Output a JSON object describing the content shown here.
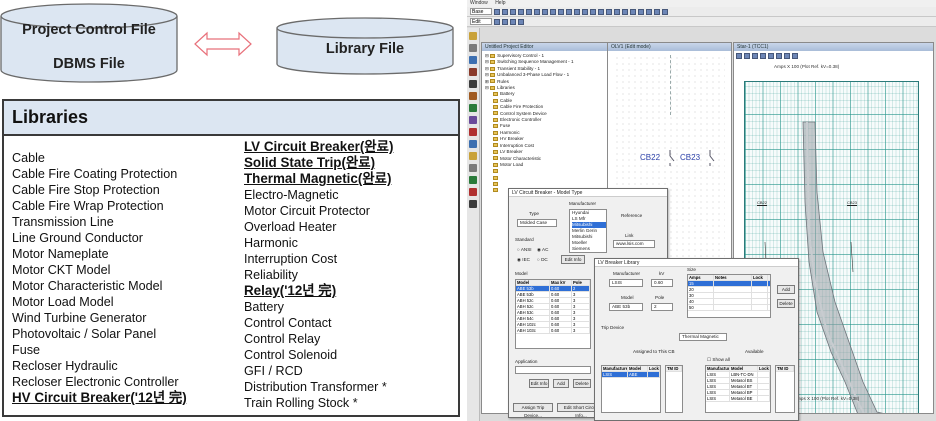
{
  "db": {
    "project_control_file": "Project Control File",
    "dbms_file": "DBMS File",
    "library_file": "Library File"
  },
  "libraries": {
    "title": "Libraries",
    "left_column": [
      "Cable",
      "Cable Fire Coating Protection",
      "Cable Fire Stop Protection",
      "Cable Fire Wrap Protection",
      "Transmission Line",
      "Line Ground Conductor",
      "Motor Nameplate",
      "Motor CKT Model",
      "Motor Characteristic Model",
      "Motor Load Model",
      "Wind Turbine Generator",
      "Photovoltaic / Solar Panel",
      "Fuse",
      "Recloser Hydraulic",
      "Recloser Electronic Controller",
      "HV Circuit Breaker('12년 完)"
    ],
    "right_column": [
      "LV Circuit Breaker(완료)",
      "Solid State Trip(완료)",
      "Thermal Magnetic(완료)",
      "Electro-Magnetic",
      "Motor Circuit Protector",
      "Overload Heater",
      "Harmonic",
      "Interruption Cost",
      "Reliability",
      "Relay('12년 完)",
      "Battery",
      "Control Contact",
      "Control Relay",
      "Control Solenoid",
      "GFI / RCD",
      "Distribution Transformer *",
      "Train Rolling Stock *"
    ]
  },
  "app": {
    "menu": [
      "Window",
      "Help"
    ],
    "toolbar_selects": [
      "Base",
      "Edit"
    ],
    "project_window_title": "Untitled Project Editor",
    "oneline_window_title": "OLV1 (Edit mode)",
    "tcc_window_title": "Star-1 (TCC1)",
    "tcc_header": "Amps X 100 (Plot Ref. kV=0.38)",
    "tcc_footer": "Amps X 100 (Plot Ref. kV=0.38)",
    "tcc_label_cb22": "CB22",
    "tcc_label_cb23": "CB23",
    "tree": [
      "Supervisory Control - 1",
      "Switching Sequence Management - 1",
      "Transient Stability - 1",
      "Unbalanced 3-Phase Load Flow - 1",
      "Rules",
      "Libraries",
      "Battery",
      "Cable",
      "Cable Fire Protection",
      "Control System Device",
      "Electronic Controller",
      "Fuse",
      "Harmonic",
      "HV Breaker",
      "Interruption Cost",
      "LV Breaker",
      "Motor Characteristic",
      "Motor Load"
    ],
    "cb22": "CB22",
    "cb23": "CB23",
    "lv_select": {
      "title": "LV Circuit Breaker - Model Type",
      "manufacturer_label": "Manufacturer",
      "manufacturers": [
        "Hyundai",
        "LS Mfr",
        "Mitsubishi",
        "Merlin Gerin",
        "Mitsubishi",
        "Moeller",
        "Siemens"
      ],
      "type_label": "Type",
      "type_value": "Molded Case",
      "reference_label": "Reference",
      "link_label": "Link",
      "link_value": "www.lsis.com",
      "standard_label": "Standard",
      "std_opts": [
        "ANSI",
        "IEC",
        "AC",
        "DC"
      ],
      "model_label": "Model",
      "model_headers": [
        "Model",
        "Max kV",
        "Pole"
      ],
      "models": [
        [
          "ABE 53b",
          "0.60",
          "2"
        ],
        [
          "ABE 53b",
          "0.60",
          "3"
        ],
        [
          "ABH 52c",
          "0.60",
          "3"
        ],
        [
          "ABH 52c",
          "0.60",
          "3"
        ],
        [
          "ABH 53c",
          "0.60",
          "3"
        ],
        [
          "ABH 54c",
          "0.60",
          "3"
        ],
        [
          "ABH 102c",
          "0.60",
          "3"
        ],
        [
          "ABH 103c",
          "0.60",
          "3"
        ]
      ],
      "application_label": "Application",
      "buttons": [
        "Edit Info",
        "Add",
        "Delete"
      ],
      "bottom_buttons": [
        "Assign Trip Device...",
        "Edit Short Circuit Info..."
      ]
    },
    "lv_library": {
      "title": "LV Breaker Library",
      "manufacturer_label": "Manufacturer",
      "manufacturer_value": "LSIS",
      "kv_label": "kV",
      "kv_value": "0.60",
      "model_label": "Model",
      "model_value": "ABE 53b",
      "pole_label": "Pole",
      "pole_value": "2",
      "size_label": "Size",
      "size_headers": [
        "Amps",
        "Notes",
        "Lock"
      ],
      "sizes": [
        [
          "15",
          "",
          ""
        ],
        [
          "20",
          "",
          ""
        ],
        [
          "30",
          "",
          ""
        ],
        [
          "40",
          "",
          ""
        ],
        [
          "50",
          "",
          ""
        ]
      ],
      "add": "Add",
      "delete": "Delete",
      "trip_device_label": "Trip Device",
      "trip_device_value": "Thermal Magnetic",
      "assigned_label": "Assigned to This CB",
      "available_label": "Available",
      "show_all": "Show all",
      "tm_headers": [
        "Manufacturer",
        "Model",
        "Lock",
        "TM ID"
      ],
      "assigned_rows": [
        [
          "LSIS",
          "ABE",
          ""
        ]
      ],
      "available_rows": [
        [
          "LSIS",
          "LBN-TC-DN",
          ""
        ],
        [
          "LSIS",
          "Metasol BS",
          ""
        ],
        [
          "LSIS",
          "Metasol BT",
          ""
        ],
        [
          "LSIS",
          "Metasol BP",
          ""
        ],
        [
          "LSIS",
          "Metasol BE",
          ""
        ]
      ]
    }
  }
}
